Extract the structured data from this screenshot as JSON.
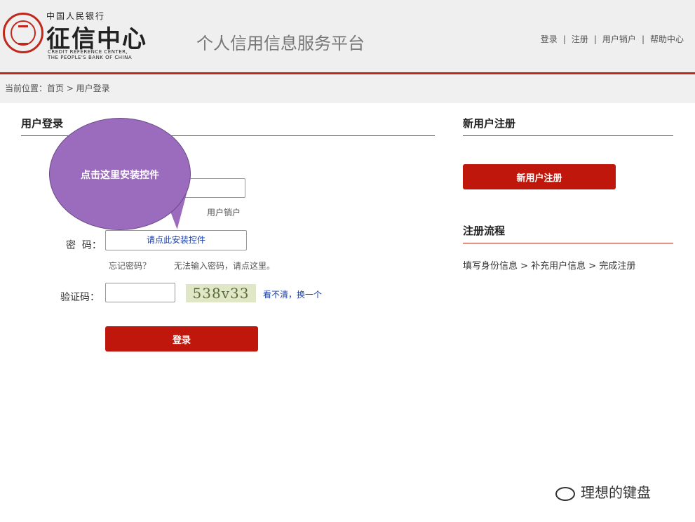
{
  "header": {
    "logo_top": "中国人民银行",
    "logo_main": "征信中心",
    "logo_en_line1": "CREDIT REFERENCE CENTER,",
    "logo_en_line2": "THE PEOPLE'S BANK OF CHINA",
    "site_title": "个人信用信息服务平台",
    "nav": [
      "登录",
      "注册",
      "用户销户",
      "帮助中心"
    ],
    "nav_sep": "|"
  },
  "breadcrumb": "当前位置：首页 > 用户登录",
  "login": {
    "title": "用户登录",
    "tooltip": "点击这里安装控件",
    "cancel_account_link": "用户销户",
    "password_label": "密  码：",
    "password_placeholder": "请点此安装控件",
    "forgot_password": "忘记密码？",
    "cant_input": "无法输入密码，请点这里。",
    "captcha_label": "验证码：",
    "captcha_value": "",
    "captcha_image_text": "538v33",
    "refresh_captcha": "看不清，换一个",
    "submit": "登录"
  },
  "register": {
    "title": "新用户注册",
    "button": "新用户注册",
    "process_title": "注册流程",
    "process_steps": "填写身份信息 > 补充用户信息 > 完成注册"
  },
  "watermark": "理想的键盘",
  "colors": {
    "brand_red": "#c0170c",
    "rule_red": "#b53427",
    "tooltip_purple": "#9b6bbd",
    "link_blue": "#1a3fa8"
  }
}
